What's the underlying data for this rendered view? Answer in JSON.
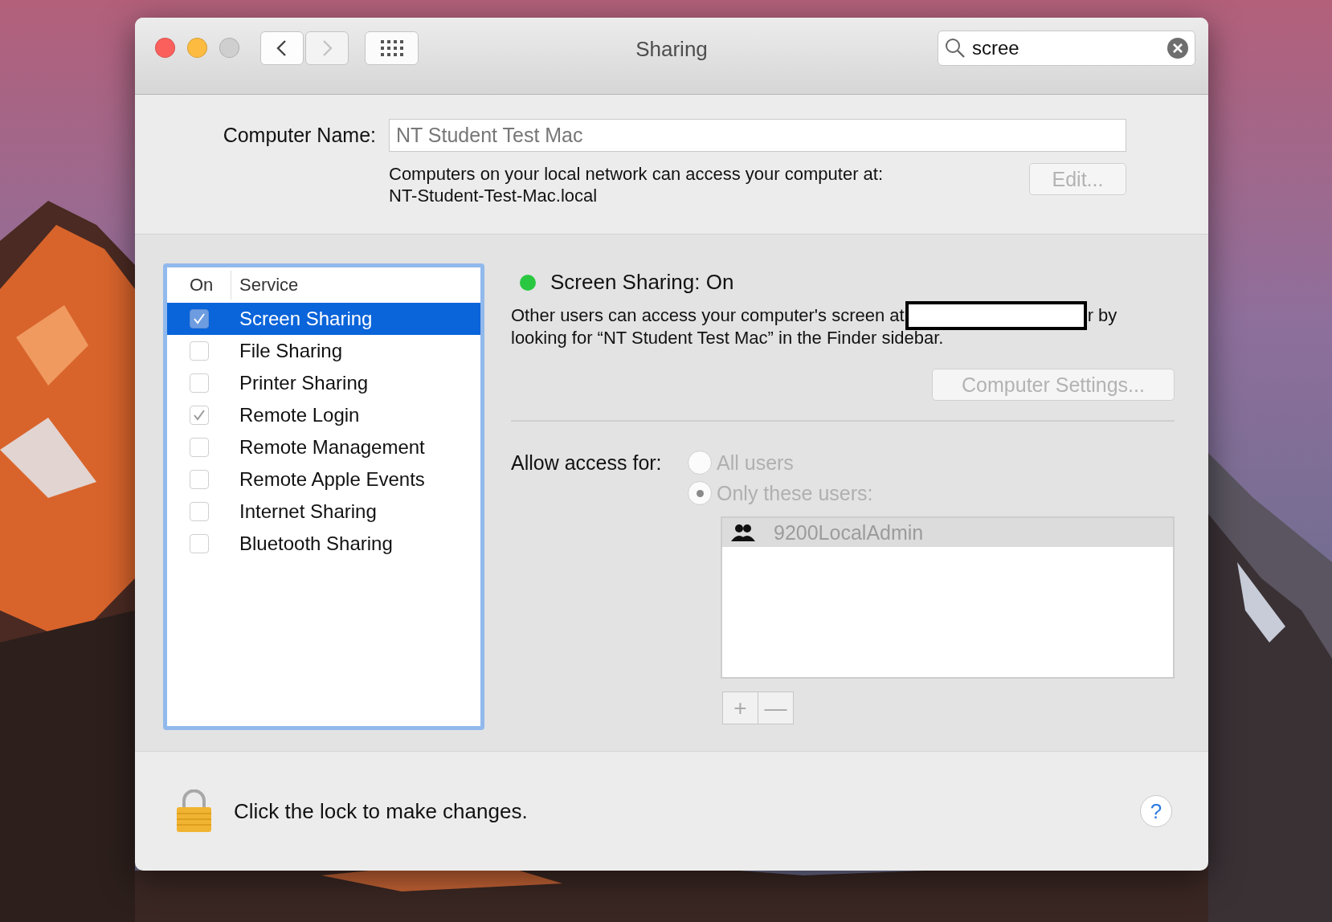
{
  "window": {
    "title": "Sharing",
    "traffic_lights": [
      {
        "kind": "close",
        "disabled": false
      },
      {
        "kind": "minimize",
        "disabled": false
      },
      {
        "kind": "zoom",
        "disabled": true
      }
    ],
    "nav": [
      {
        "kind": "back",
        "disabled": false
      },
      {
        "kind": "forward",
        "disabled": true
      }
    ]
  },
  "search": {
    "value": "scree"
  },
  "computer_name": {
    "label": "Computer Name:",
    "value": "NT Student Test Mac",
    "note_lines": [
      "Computers on your local network can access your computer at:",
      "NT-Student-Test-Mac.local"
    ],
    "edit_button": "Edit..."
  },
  "services": {
    "columns": [
      "On",
      "Service"
    ],
    "rows": [
      {
        "name": "Screen Sharing",
        "checked": true,
        "selected": true
      },
      {
        "name": "File Sharing",
        "checked": false,
        "selected": false
      },
      {
        "name": "Printer Sharing",
        "checked": false,
        "selected": false
      },
      {
        "name": "Remote Login",
        "checked": true,
        "selected": false
      },
      {
        "name": "Remote Management",
        "checked": false,
        "selected": false
      },
      {
        "name": "Remote Apple Events",
        "checked": false,
        "selected": false
      },
      {
        "name": "Internet Sharing",
        "checked": false,
        "selected": false
      },
      {
        "name": "Bluetooth Sharing",
        "checked": false,
        "selected": false
      }
    ]
  },
  "detail": {
    "status": {
      "text": "Screen Sharing: On",
      "color": "#2ac840"
    },
    "description_before": "Other users can access your computer's screen at",
    "description_after": "r by",
    "description_line2": "looking for “NT Student Test Mac” in the Finder sidebar.",
    "settings_button": "Computer Settings...",
    "access_label": "Allow access for:",
    "access_options": [
      {
        "label": "All users",
        "selected": false
      },
      {
        "label": "Only these users:",
        "selected": true
      }
    ],
    "users": [
      {
        "name": "9200LocalAdmin",
        "selected": true
      }
    ],
    "list_buttons": [
      "+",
      "—"
    ]
  },
  "footer": {
    "lock_text": "Click the lock to make changes.",
    "help": "?"
  }
}
